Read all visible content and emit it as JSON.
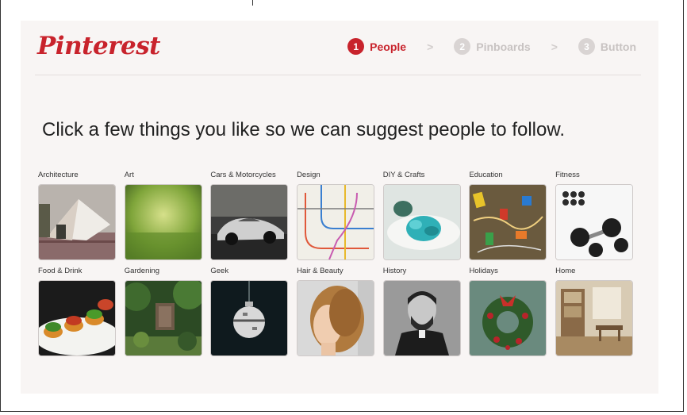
{
  "brand": {
    "logo_text": "Pinterest",
    "color": "#c8232c"
  },
  "steps": [
    {
      "number": "1",
      "label": "People",
      "active": true
    },
    {
      "number": "2",
      "label": "Pinboards",
      "active": false
    },
    {
      "number": "3",
      "label": "Button",
      "active": false
    }
  ],
  "step_separator": ">",
  "headline": "Click a few things you like so we can suggest people to follow.",
  "categories": [
    {
      "label": "Architecture",
      "icon": "architecture-photo"
    },
    {
      "label": "Art",
      "icon": "art-photo"
    },
    {
      "label": "Cars & Motorcycles",
      "icon": "car-photo"
    },
    {
      "label": "Design",
      "icon": "design-map-photo"
    },
    {
      "label": "DIY & Crafts",
      "icon": "crafts-photo"
    },
    {
      "label": "Education",
      "icon": "education-photo"
    },
    {
      "label": "Fitness",
      "icon": "dumbbell-photo"
    },
    {
      "label": "Food & Drink",
      "icon": "food-photo"
    },
    {
      "label": "Gardening",
      "icon": "garden-photo"
    },
    {
      "label": "Geek",
      "icon": "ornament-photo"
    },
    {
      "label": "Hair & Beauty",
      "icon": "hair-photo"
    },
    {
      "label": "History",
      "icon": "portrait-photo"
    },
    {
      "label": "Holidays",
      "icon": "wreath-photo"
    },
    {
      "label": "Home",
      "icon": "home-interior-photo"
    }
  ]
}
